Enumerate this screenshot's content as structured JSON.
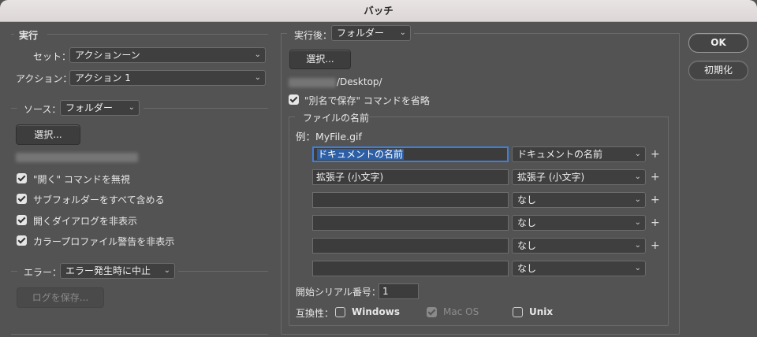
{
  "window": {
    "title": "バッチ"
  },
  "execute": {
    "group_label": "実行",
    "set_label": "セット：",
    "set_value": "アクションーン",
    "action_label": "アクション：",
    "action_value": "アクション 1"
  },
  "source": {
    "label": "ソース：",
    "value": "フォルダー",
    "choose_button": "選択...",
    "options": [
      {
        "label": "\"開く\" コマンドを無視",
        "checked": true
      },
      {
        "label": "サブフォルダーをすべて含める",
        "checked": true
      },
      {
        "label": "開くダイアログを非表示",
        "checked": true
      },
      {
        "label": "カラープロファイル警告を非表示",
        "checked": true
      }
    ]
  },
  "errors": {
    "label": "エラー：",
    "value": "エラー発生時に中止",
    "save_log_button": "ログを保存..."
  },
  "destination": {
    "label": "実行後：",
    "value": "フォルダー",
    "choose_button": "選択...",
    "path_suffix": "/Desktop/",
    "override_save_as": {
      "label": "\"別名で保存\" コマンドを省略",
      "checked": true
    }
  },
  "file_naming": {
    "group_label": "ファイルの名前",
    "example": "例：MyFile.gif",
    "rows": [
      {
        "field": "ドキュメントの名前",
        "select": "ドキュメントの名前",
        "plus": "+"
      },
      {
        "field": "拡張子 (小文字)",
        "select": "拡張子 (小文字)",
        "plus": "+"
      },
      {
        "field": "",
        "select": "なし",
        "plus": "+"
      },
      {
        "field": "",
        "select": "なし",
        "plus": "+"
      },
      {
        "field": "",
        "select": "なし",
        "plus": "+"
      },
      {
        "field": "",
        "select": "なし",
        "plus": ""
      }
    ],
    "serial_label": "開始シリアル番号：",
    "serial_value": "1",
    "compat_label": "互換性：",
    "compat": [
      {
        "label": "Windows",
        "checked": false,
        "enabled": true
      },
      {
        "label": "Mac OS",
        "checked": true,
        "enabled": false
      },
      {
        "label": "Unix",
        "checked": false,
        "enabled": true
      }
    ]
  },
  "actions": {
    "ok": "OK",
    "reset": "初期化"
  },
  "icons": {
    "chevron": "chevron-down-icon",
    "check": "checkmark-icon"
  },
  "colors": {
    "panel": "#535353",
    "titlebar": "#e3dede",
    "field": "#3c3c3c",
    "highlight": "#2d5fa6"
  }
}
